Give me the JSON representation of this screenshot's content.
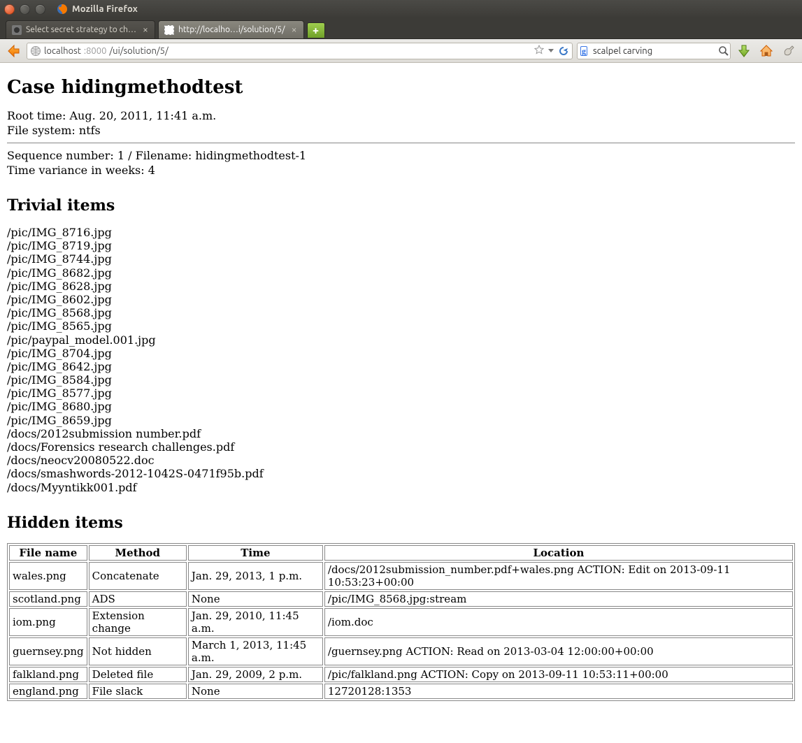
{
  "window": {
    "title": "Mozilla Firefox"
  },
  "tabs": [
    {
      "label": "Select secret strategy to ch…",
      "active": false
    },
    {
      "label": "http://localho…i/solution/5/",
      "active": true
    }
  ],
  "urlbar": {
    "host": "localhost",
    "port": ":8000",
    "path": "/ui/solution/5/"
  },
  "searchbar": {
    "value": "scalpel carving"
  },
  "page": {
    "h1": "Case hidingmethodtest",
    "root_time_label": "Root time: Aug. 20, 2011, 11:41 a.m.",
    "fs_label": "File system: ntfs",
    "seq_label": "Sequence number: 1 / Filename: hidingmethodtest-1",
    "variance_label": "Time variance in weeks: 4",
    "h2_trivial": "Trivial items",
    "trivial": [
      "/pic/IMG_8716.jpg",
      "/pic/IMG_8719.jpg",
      "/pic/IMG_8744.jpg",
      "/pic/IMG_8682.jpg",
      "/pic/IMG_8628.jpg",
      "/pic/IMG_8602.jpg",
      "/pic/IMG_8568.jpg",
      "/pic/IMG_8565.jpg",
      "/pic/paypal_model.001.jpg",
      "/pic/IMG_8704.jpg",
      "/pic/IMG_8642.jpg",
      "/pic/IMG_8584.jpg",
      "/pic/IMG_8577.jpg",
      "/pic/IMG_8680.jpg",
      "/pic/IMG_8659.jpg",
      "/docs/2012submission number.pdf",
      "/docs/Forensics research challenges.pdf",
      "/docs/neocv20080522.doc",
      "/docs/smashwords-2012-1042S-0471f95b.pdf",
      "/docs/Myyntikk001.pdf"
    ],
    "h2_hidden": "Hidden items",
    "hidden_headers": {
      "file": "File name",
      "method": "Method",
      "time": "Time",
      "location": "Location"
    },
    "hidden_rows": [
      {
        "file": "wales.png",
        "method": "Concatenate",
        "time": "Jan. 29, 2013, 1 p.m.",
        "location": "/docs/2012submission_number.pdf+wales.png ACTION: Edit on 2013-09-11 10:53:23+00:00"
      },
      {
        "file": "scotland.png",
        "method": "ADS",
        "time": "None",
        "location": "/pic/IMG_8568.jpg:stream"
      },
      {
        "file": "iom.png",
        "method": "Extension change",
        "time": "Jan. 29, 2010, 11:45 a.m.",
        "location": "/iom.doc"
      },
      {
        "file": "guernsey.png",
        "method": "Not hidden",
        "time": "March 1, 2013, 11:45 a.m.",
        "location": "/guernsey.png ACTION: Read on 2013-03-04 12:00:00+00:00"
      },
      {
        "file": "falkland.png",
        "method": "Deleted file",
        "time": "Jan. 29, 2009, 2 p.m.",
        "location": "/pic/falkland.png ACTION: Copy on 2013-09-11 10:53:11+00:00"
      },
      {
        "file": "england.png",
        "method": "File slack",
        "time": "None",
        "location": "12720128:1353"
      }
    ]
  }
}
